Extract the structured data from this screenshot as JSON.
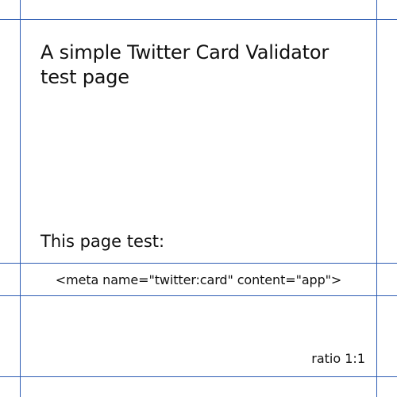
{
  "page": {
    "title": "A simple Twitter Card Validator test page",
    "subtitle": "This page test:",
    "meta_tag": "<meta name=\"twitter:card\" content=\"app\">",
    "ratio": "ratio 1:1"
  },
  "colors": {
    "guide_line": "#2f5db4",
    "background": "#ffffff",
    "text": "#111111"
  }
}
